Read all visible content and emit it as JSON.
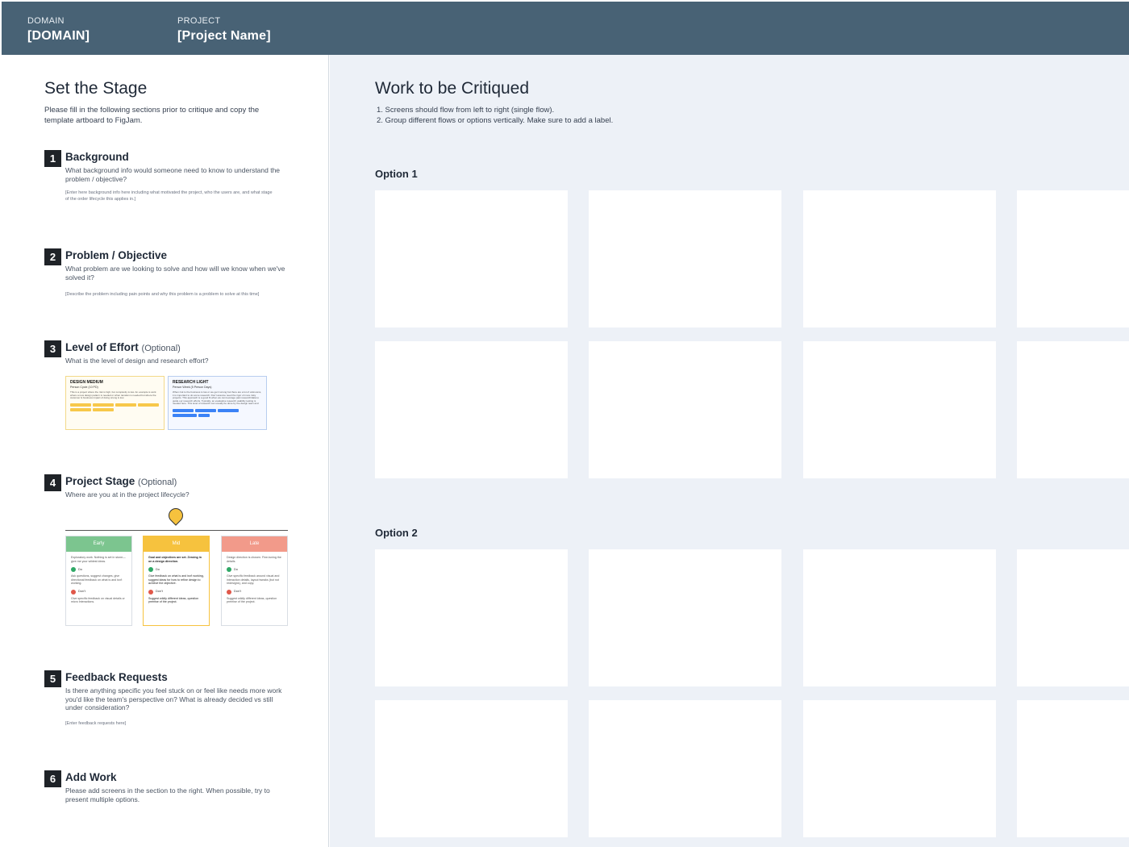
{
  "header": {
    "domain_label": "DOMAIN",
    "domain_value": "[DOMAIN]",
    "project_label": "PROJECT",
    "project_value": "[Project Name]"
  },
  "stage": {
    "title": "Set the Stage",
    "description": "Please fill in the following sections prior to critique and copy the template artboard to FigJam."
  },
  "sections": [
    {
      "number": "1",
      "title": "Background",
      "optional": "",
      "question": "What background info would someone need to know to understand the problem / objective?",
      "hint": "[Enter here background info here including what motivated the project, who the users are, and what stage of the order lifecycle this applies in.]"
    },
    {
      "number": "2",
      "title": "Problem / Objective",
      "optional": "",
      "question": "What problem are we looking to solve and how will we know when we've solved it?",
      "hint": "[Describe the problem including pain points and why this problem is a problem to solve at this time]"
    },
    {
      "number": "3",
      "title": "Level of Effort",
      "optional": "(Optional)",
      "question": "What is the level of design and research effort?",
      "hint": ""
    },
    {
      "number": "4",
      "title": "Project Stage",
      "optional": "(Optional)",
      "question": "Where are you at in the project lifecycle?",
      "hint": ""
    },
    {
      "number": "5",
      "title": "Feedback Requests",
      "optional": "",
      "question": "Is there anything specific you feel stuck on or feel like needs more work you'd like the team's perspective on? What is already decided vs still under consideration?",
      "hint": "[Enter feedback requests here]"
    },
    {
      "number": "6",
      "title": "Add Work",
      "optional": "",
      "question": "Please add screens in the section to the right. When possible, try to present multiple options.",
      "hint": ""
    }
  ],
  "effort_cards": [
    {
      "title": "DESIGN MEDIUM",
      "subtitle": "Person Cycle (10 PD)",
      "text": "This is a project where the risk is high, but complexity is low. An example is work where a new design pattern is needed or when iteration is needed but where the customer & business impact of doing wrong is low.",
      "color": "#f7c84a"
    },
    {
      "title": "RESEARCH LIGHT",
      "subtitle": "Person Week (5 Person Days)",
      "text": "When risk to the business is low or we get it wrong but there are a lot of unknowns, it is important to do some research. Don't assume need the rigor of more risky projects. This approach is a good fit when we can leverage past research/data to guide our research efforts. Typically, an evaluative research usability testing is needed here. This level of research can usually be done by the design team and doesn't require a dedicated researcher.",
      "color": "#3b82f6"
    }
  ],
  "project_stages": [
    {
      "name": "Early",
      "color": "#7cc58f",
      "summary": "Exploratory work. Nothing is set in stone—give me your wildest ideas.",
      "do_label": "Do",
      "do_text": "Ask questions, suggest changes, give directional feedback on what is and isn't working.",
      "dont_label": "Don't",
      "dont_text": "Give specific feedback on visual details or micro interactions."
    },
    {
      "name": "Mid",
      "color": "#f6c23e",
      "summary": "Goal and objectives are set. Zeroing in on a design direction.",
      "do_label": "Do",
      "do_text": "Give feedback on what is and isn't working, suggest ideas for how to refine design to achieve the objective.",
      "dont_label": "Don't",
      "dont_text": "Suggest wildly different ideas, question premise of the project."
    },
    {
      "name": "Late",
      "color": "#f29a8a",
      "summary": "Design direction is chosen. Fine-tuning the details.",
      "do_label": "Do",
      "do_text": "Give specific feedback around visual and interaction details, layout tweaks (but not redesigns), and copy.",
      "dont_label": "Don't",
      "dont_text": "Suggest wildly different ideas, question premise of the project."
    }
  ],
  "work": {
    "title": "Work to be Critiqued",
    "instructions": [
      "1.  Screens should flow from left to right (single flow).",
      "2.  Group different flows or options vertically. Make sure to add a label."
    ],
    "options": [
      {
        "label": "Option 1"
      },
      {
        "label": "Option 2"
      }
    ]
  }
}
